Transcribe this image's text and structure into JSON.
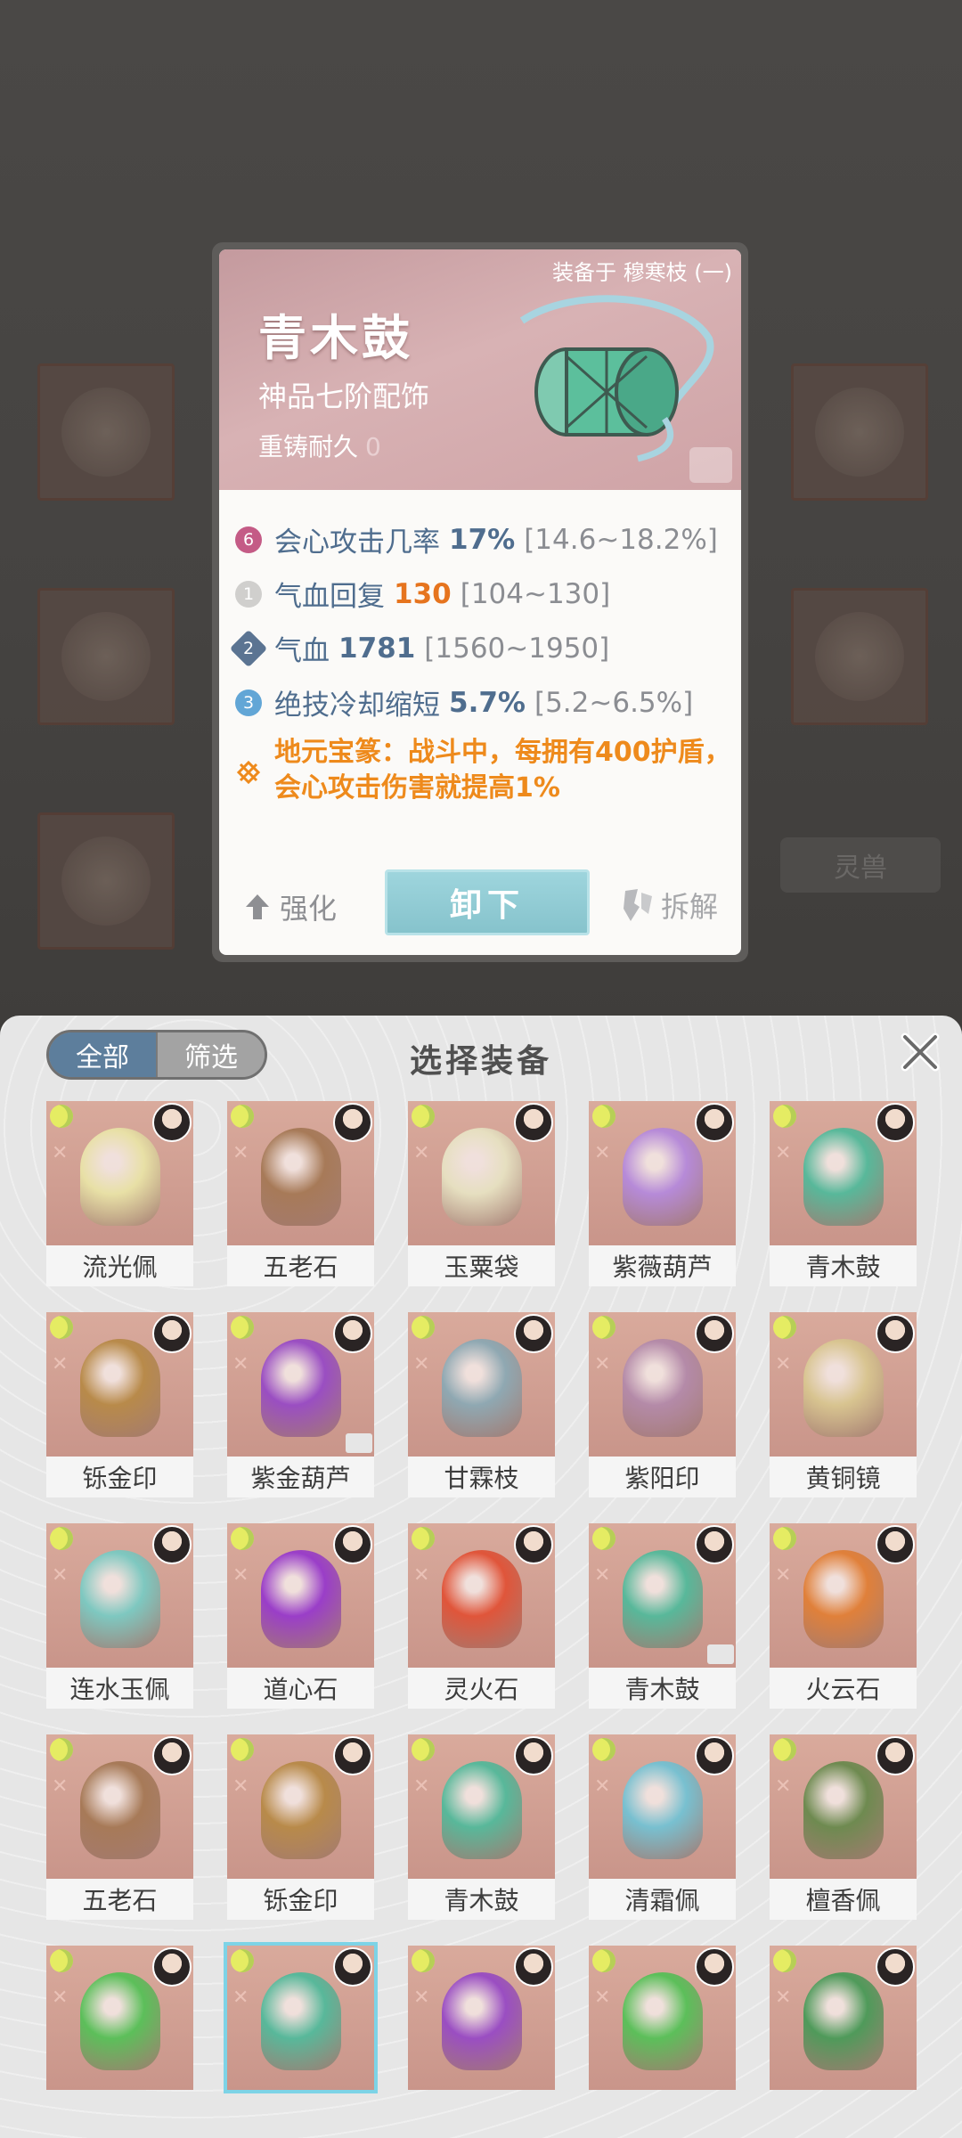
{
  "card": {
    "equipped_on": "装备于 穆寒枝 (一)",
    "name": "青木鼓",
    "grade": "神品七阶配饰",
    "recast_label": "重铸耐久",
    "recast_value": "0",
    "stats": [
      {
        "badge": "6",
        "name": "会心攻击几率",
        "value": "17%",
        "range": "[14.6~18.2%]"
      },
      {
        "badge": "1",
        "name": "气血回复",
        "value": "130",
        "range": "[104~130]"
      },
      {
        "badge": "2",
        "name": "气血",
        "value": "1781",
        "range": "[1560~1950]"
      },
      {
        "badge": "3",
        "name": "绝技冷却缩短",
        "value": "5.7%",
        "range": "[5.2~6.5%]"
      }
    ],
    "special_text": "地元宝篆：战斗中，每拥有400护盾，会心攻击伤害就提高1%",
    "buttons": {
      "enhance": "强化",
      "unequip": "卸下",
      "dismantle": "拆解"
    }
  },
  "background": {
    "tag": "灵兽"
  },
  "panel": {
    "tabs": [
      "全部",
      "筛选"
    ],
    "title": "选择装备",
    "items": [
      {
        "label": "流光佩",
        "color": "#e8e0a6"
      },
      {
        "label": "五老石",
        "color": "#a77a58"
      },
      {
        "label": "玉粟袋",
        "color": "#e6dfc0"
      },
      {
        "label": "紫薇葫芦",
        "color": "#b68ad8"
      },
      {
        "label": "青木鼓",
        "color": "#58b89a"
      },
      {
        "label": "铄金印",
        "color": "#b88a4a"
      },
      {
        "label": "紫金葫芦",
        "color": "#9a4ec2"
      },
      {
        "label": "甘霖枝",
        "color": "#8fa8b2"
      },
      {
        "label": "紫阳印",
        "color": "#b48aa8"
      },
      {
        "label": "黄铜镜",
        "color": "#d8c490"
      },
      {
        "label": "连水玉佩",
        "color": "#7ec8c0"
      },
      {
        "label": "道心石",
        "color": "#9a3ec8"
      },
      {
        "label": "灵火石",
        "color": "#e0553a"
      },
      {
        "label": "青木鼓",
        "color": "#58b89a"
      },
      {
        "label": "火云石",
        "color": "#e0803a"
      },
      {
        "label": "五老石",
        "color": "#a77a58"
      },
      {
        "label": "铄金印",
        "color": "#b88a4a"
      },
      {
        "label": "青木鼓",
        "color": "#58b89a"
      },
      {
        "label": "清霜佩",
        "color": "#78c0d0"
      },
      {
        "label": "檀香佩",
        "color": "#6e8a50"
      },
      {
        "label": "",
        "color": "#5cbf5a"
      },
      {
        "label": "",
        "color": "#58b89a"
      },
      {
        "label": "",
        "color": "#9a4ec2"
      },
      {
        "label": "",
        "color": "#5cbf5a"
      },
      {
        "label": "",
        "color": "#4f9a5a"
      }
    ]
  }
}
